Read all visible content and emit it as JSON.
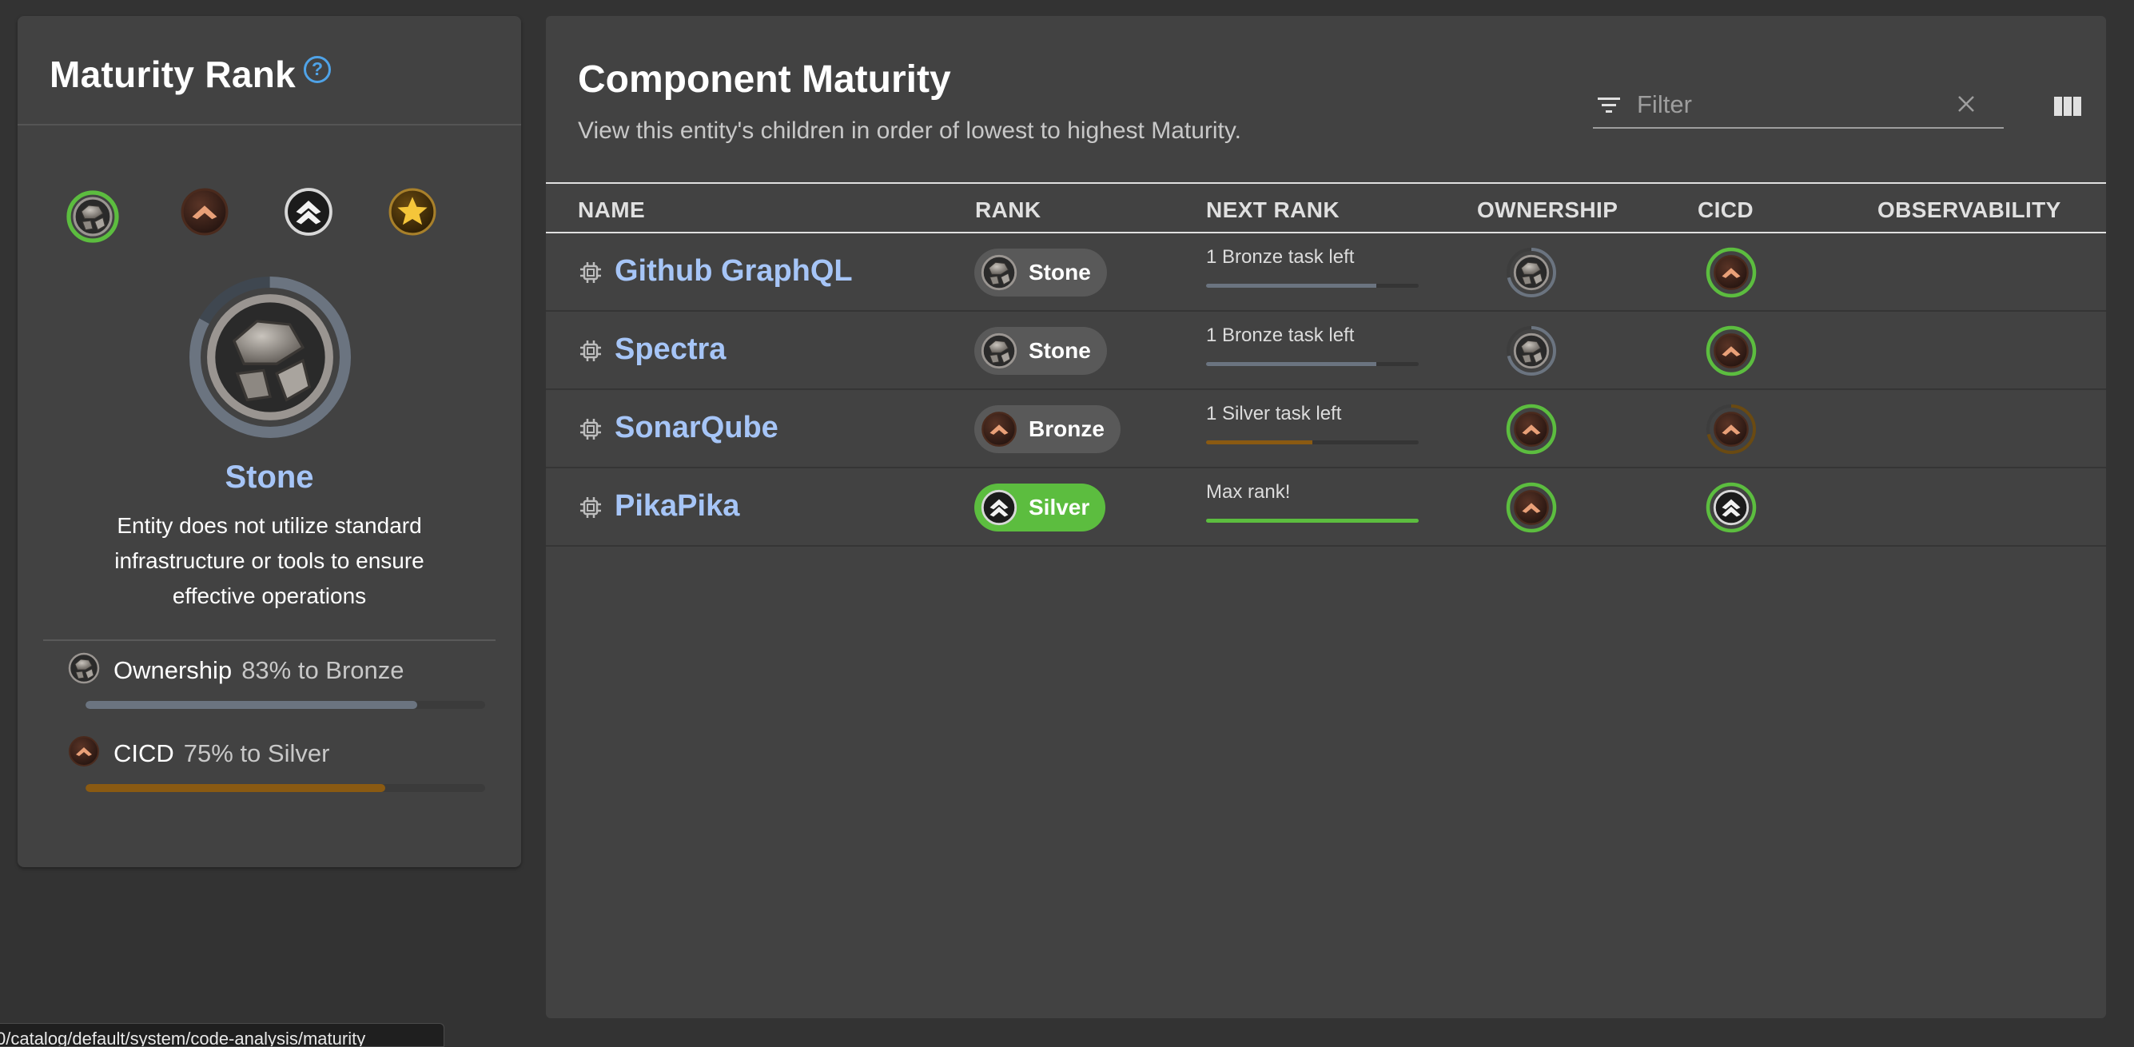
{
  "maturity_card": {
    "title": "Maturity Rank",
    "help_icon": "help-circle-icon",
    "tiers": [
      "stone-badge-icon",
      "bronze-badge-icon",
      "silver-badge-icon",
      "gold-badge-icon"
    ],
    "current_tier_index": 0,
    "rank_name": "Stone",
    "rank_description": "Entity does not utilize standard infrastructure or tools to ensure effective operations",
    "categories": [
      {
        "name": "Ownership",
        "progress_text": "83% to Bronze",
        "progress": 0.83,
        "icon": "stone-badge-icon",
        "color": "#6b7480"
      },
      {
        "name": "CICD",
        "progress_text": "75% to Silver",
        "progress": 0.75,
        "icon": "bronze-badge-icon",
        "color": "#8a5a12"
      }
    ]
  },
  "component_maturity": {
    "title": "Component Maturity",
    "subtitle": "View this entity's children in order of lowest to highest Maturity.",
    "filter": {
      "placeholder": "Filter",
      "value": ""
    },
    "columns": [
      "NAME",
      "RANK",
      "NEXT RANK",
      "OWNERSHIP",
      "CICD",
      "OBSERVABILITY"
    ],
    "rows": [
      {
        "name": "Github GraphQL",
        "rank": "Stone",
        "next_rank": "1 Bronze task left",
        "next_progress": 0.8,
        "ownership": "stone",
        "ownership_ring": "partial",
        "cicd": "bronze",
        "cicd_ring": "complete"
      },
      {
        "name": "Spectra",
        "rank": "Stone",
        "next_rank": "1 Bronze task left",
        "next_progress": 0.8,
        "ownership": "stone",
        "ownership_ring": "partial",
        "cicd": "bronze",
        "cicd_ring": "complete"
      },
      {
        "name": "SonarQube",
        "rank": "Bronze",
        "next_rank": "1 Silver task left",
        "next_progress": 0.5,
        "ownership": "bronze",
        "ownership_ring": "complete",
        "cicd": "bronze",
        "cicd_ring": "partial"
      },
      {
        "name": "PikaPika",
        "rank": "Silver",
        "next_rank": "Max rank!",
        "next_progress": 1.0,
        "ownership": "bronze",
        "ownership_ring": "complete",
        "cicd": "silver",
        "cicd_ring": "complete"
      }
    ]
  },
  "status_url": "0/catalog/default/system/code-analysis/maturity",
  "colors": {
    "link": "#a6c5f7",
    "complete": "#5cbd3f",
    "stone": "#6b7480",
    "bronze": "#8a5a12",
    "help": "#4fa3e8"
  }
}
